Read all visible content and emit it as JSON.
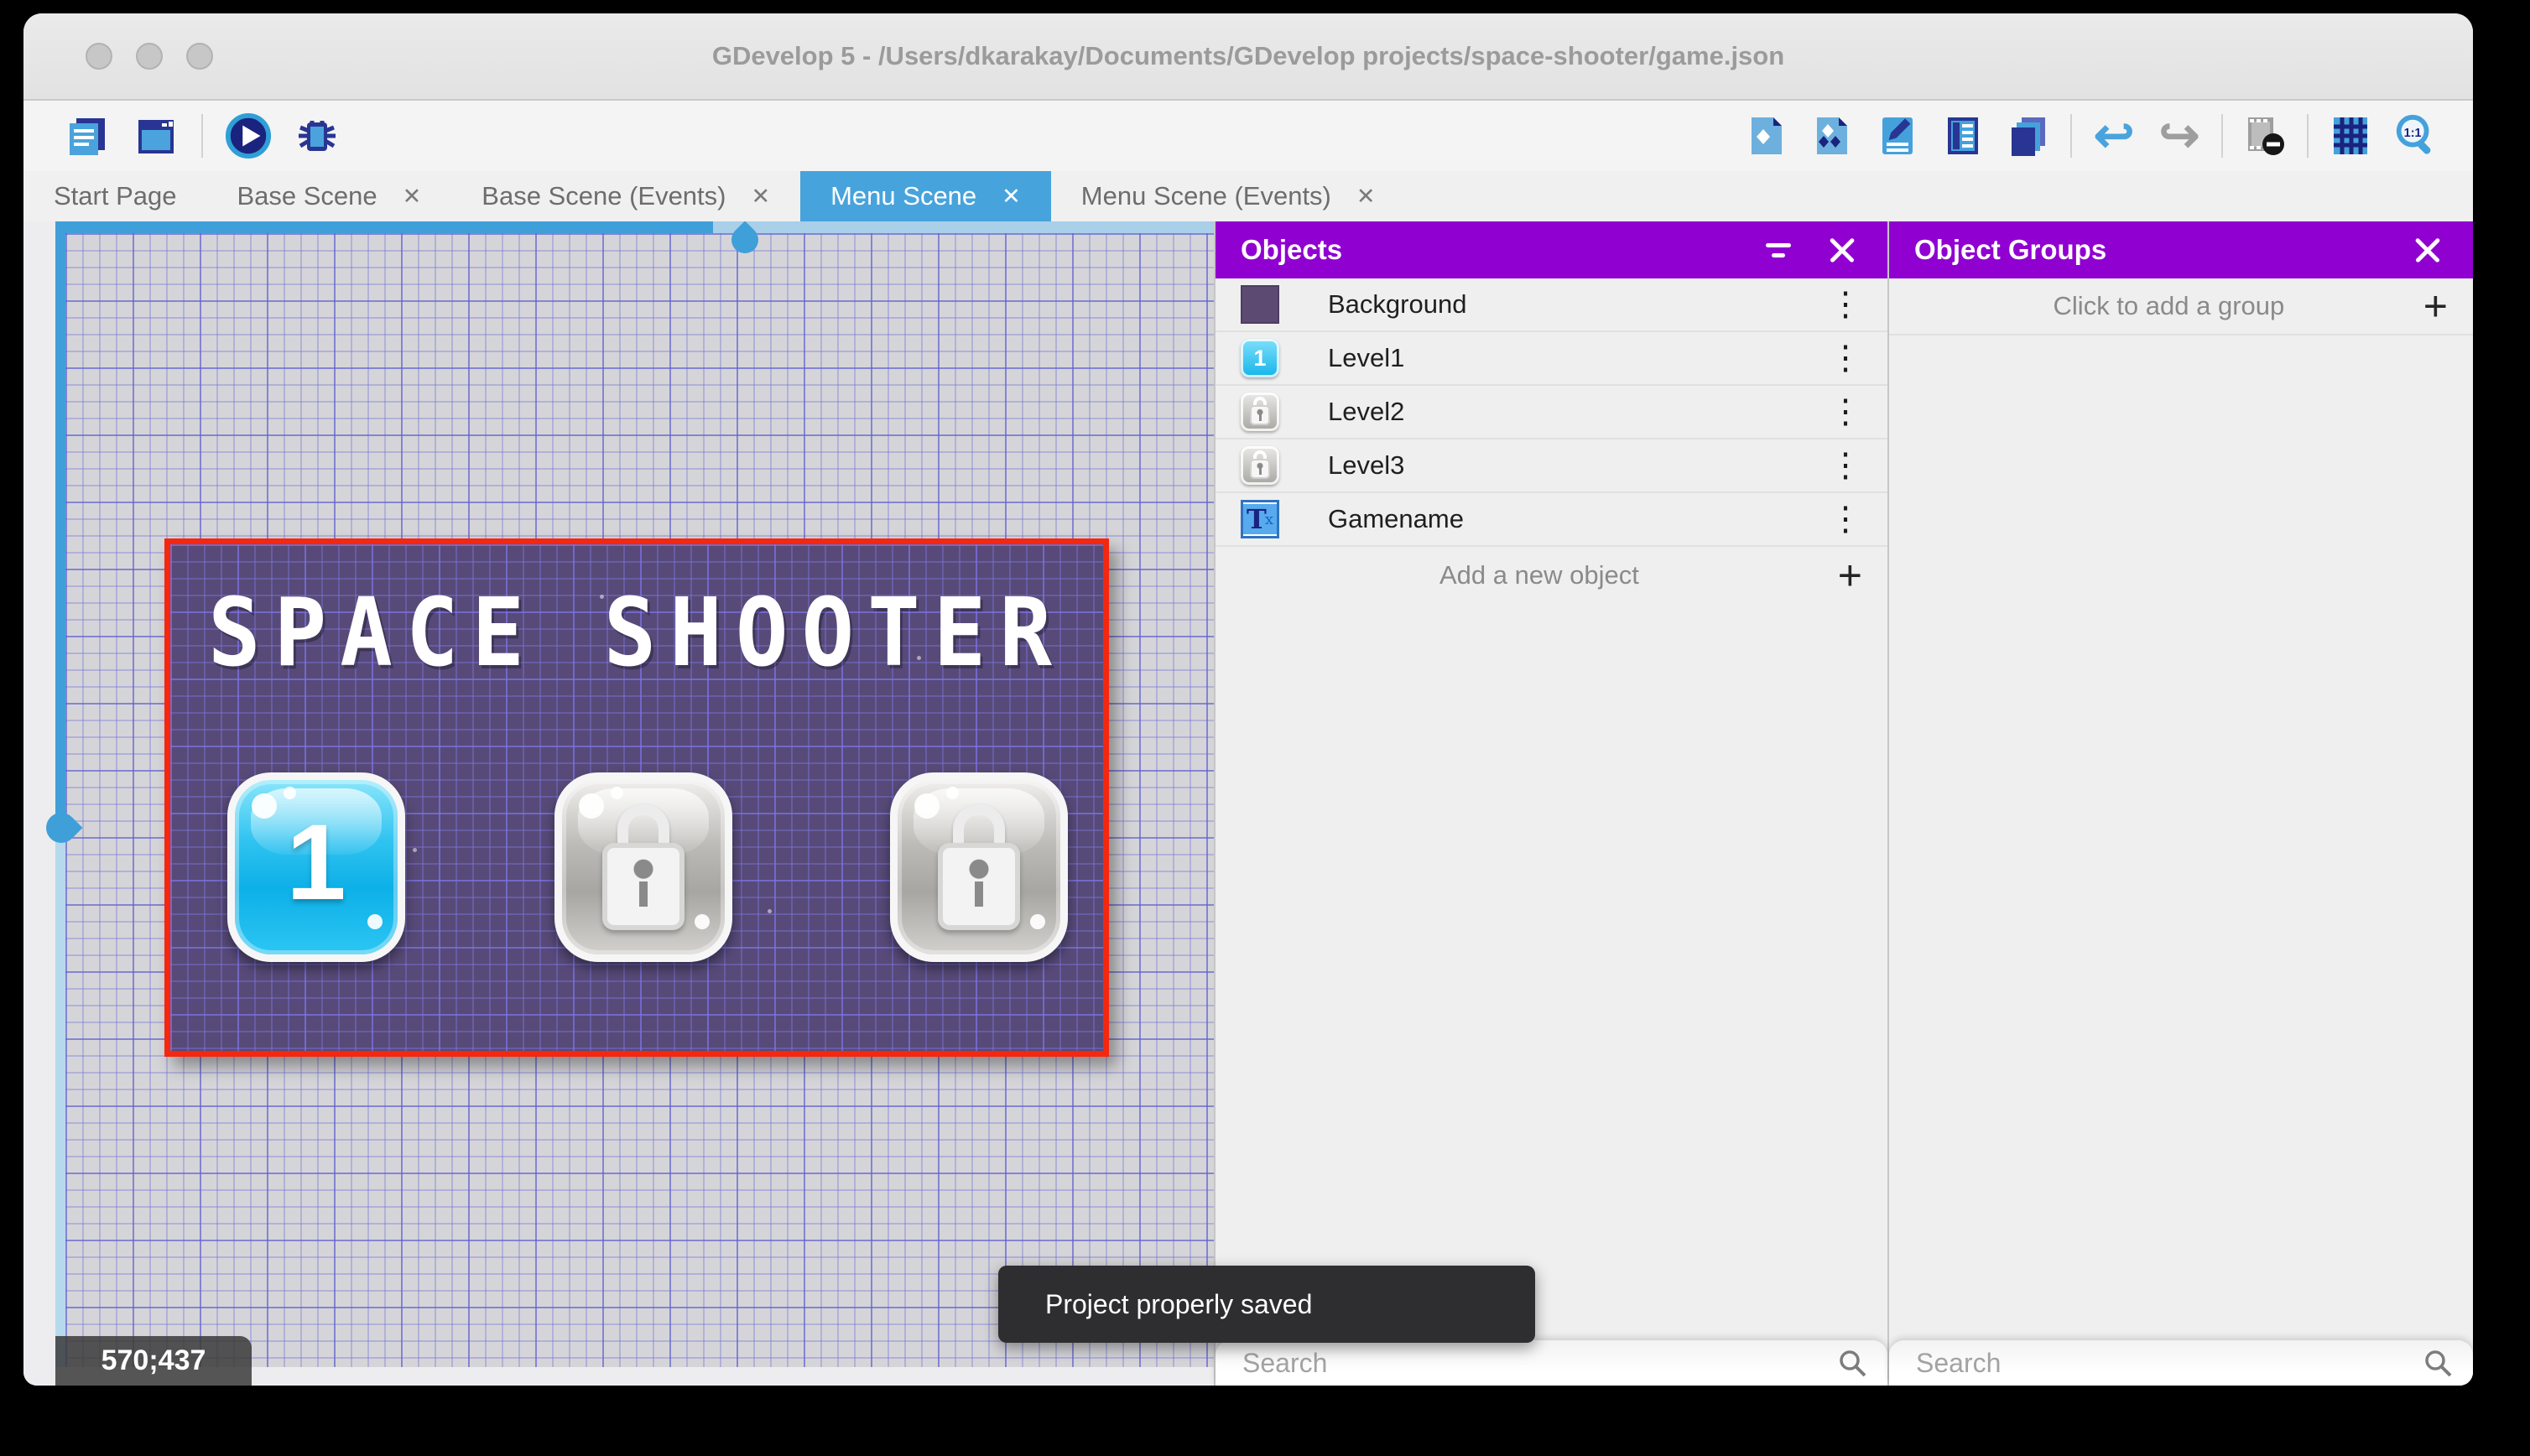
{
  "window": {
    "title": "GDevelop 5 - /Users/dkarakay/Documents/GDevelop projects/space-shooter/game.json"
  },
  "toolbar": {
    "zoom_label": "1:1"
  },
  "icons": {
    "close": "✕",
    "plus": "+",
    "kebab": "⋮",
    "undo": "↩",
    "redo": "↪"
  },
  "tabs": [
    {
      "label": "Start Page",
      "closable": false,
      "active": false
    },
    {
      "label": "Base Scene",
      "closable": true,
      "active": false
    },
    {
      "label": "Base Scene (Events)",
      "closable": true,
      "active": false
    },
    {
      "label": "Menu Scene",
      "closable": true,
      "active": true
    },
    {
      "label": "Menu Scene (Events)",
      "closable": true,
      "active": false
    }
  ],
  "canvas": {
    "coordinates": "570;437",
    "toast": "Project properly saved",
    "scene": {
      "title": "SPACE SHOOTER",
      "buttons": [
        {
          "label": "1",
          "state": "unlocked"
        },
        {
          "label": "",
          "state": "locked"
        },
        {
          "label": "",
          "state": "locked"
        }
      ]
    }
  },
  "objects_panel": {
    "title": "Objects",
    "items": [
      {
        "label": "Background"
      },
      {
        "label": "Level1",
        "thumb_text": "1"
      },
      {
        "label": "Level2"
      },
      {
        "label": "Level3"
      },
      {
        "label": "Gamename",
        "thumb_T": "T",
        "thumb_x": "x"
      }
    ],
    "add_label": "Add a new object",
    "search_placeholder": "Search"
  },
  "groups_panel": {
    "title": "Object Groups",
    "add_label": "Click to add a group",
    "search_placeholder": "Search"
  },
  "colors": {
    "panel_header": "#9001d1",
    "active_tab": "#47a3dc",
    "scene_border": "#f5270f",
    "scene_background": "#574a78",
    "scrollbar": "#3f9fd9",
    "toast_background": "#2e2e30"
  }
}
